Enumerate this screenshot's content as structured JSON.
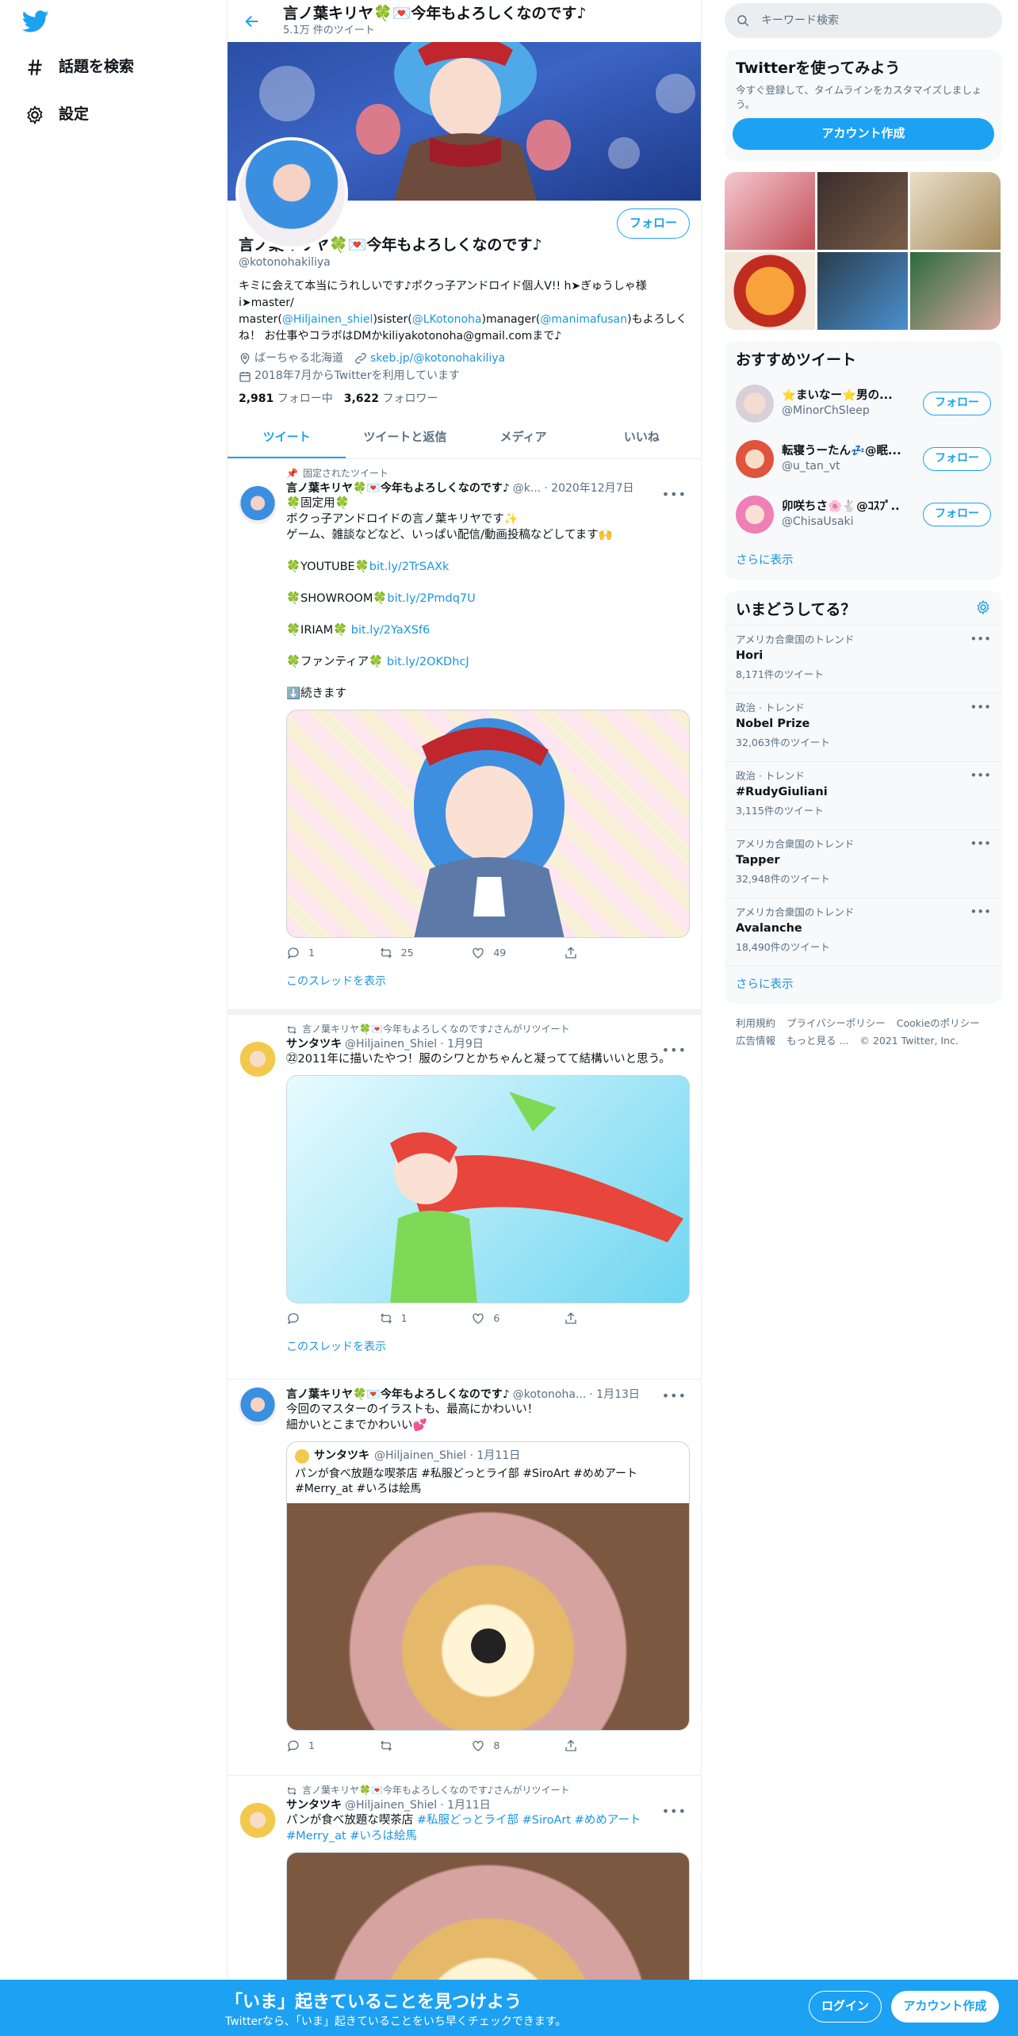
{
  "nav": {
    "explore": "話題を検索",
    "settings": "設定"
  },
  "header": {
    "name": "言ノ葉キリヤ🍀💌今年もよろしくなのです♪",
    "tweet_count": "5.1万 件のツイート"
  },
  "profile": {
    "follow_label": "フォロー",
    "name": "言ノ葉キリヤ🍀💌今年もよろしくなのです♪",
    "handle": "@kotonohakiliya",
    "bio_part1": "キミに会えて本当にうれしいです♪ポクっ子アンドロイド個人V!! h➤ぎゅうしゃ様i➤master/ master(",
    "bio_link1": "@Hiljainen_shiel",
    "bio_part2": ")sister(",
    "bio_link2": "@LKotonoha",
    "bio_part3": ")manager(",
    "bio_link3": "@manimafusan",
    "bio_part4": ")もよろしくね！ お仕事やコラボはDMかkiliyakotonoha@gmail.comまで♪",
    "location": "ばーちゃる北海道",
    "website": "skeb.jp/@kotonohakiliya",
    "joined": "2018年7月からTwitterを利用しています",
    "following_count": "2,981",
    "following_label": "フォロー中",
    "followers_count": "3,622",
    "followers_label": "フォロワー"
  },
  "tabs": [
    "ツイート",
    "ツイートと返信",
    "メディア",
    "いいね"
  ],
  "tweets": [
    {
      "context": "固定されたツイート",
      "name": "言ノ葉キリヤ🍀💌今年もよろしくなのです♪",
      "handle": "@k...",
      "date": "· 2020年12月7日",
      "text": "🍀固定用🍀\nボクっ子アンドロイドの言ノ葉キリヤです✨\nゲーム、雑談などなど、いっぱい配信/動画投稿などしてます🙌",
      "links": [
        {
          "label": "🍀YOUTUBE🍀",
          "url": "bit.ly/2TrSAXk"
        },
        {
          "label": "🍀SHOWROOM🍀",
          "url": "bit.ly/2Pmdq7U"
        },
        {
          "label": "🍀IRIAM🍀 ",
          "url": "bit.ly/2YaXSf6"
        },
        {
          "label": "🍀ファンティア🍀 ",
          "url": "bit.ly/2OKDhcJ"
        }
      ],
      "continue": "⬇️続きます",
      "replies": "1",
      "retweets": "25",
      "likes": "49",
      "show_thread": "このスレッドを表示"
    },
    {
      "context": "言ノ葉キリヤ🍀💌今年もよろしくなのです♪さんがリツイート",
      "name": "サンタツキ",
      "handle": "@Hiljainen_Shiel",
      "date": "· 1月9日",
      "text": "㉒2011年に描いたやつ！服のシワとかちゃんと凝ってて結構いいと思う。",
      "replies": "",
      "retweets": "1",
      "likes": "6",
      "show_thread": "このスレッドを表示"
    },
    {
      "name": "言ノ葉キリヤ🍀💌今年もよろしくなのです♪",
      "handle": "@kotonoha...",
      "date": "· 1月13日",
      "text": "今回のマスターのイラストも、最高にかわいい！\n細かいとこまでかわいい💕",
      "quote": {
        "name": "サンタツキ",
        "handle": "@Hiljainen_Shiel · 1月11日",
        "text": "パンが食べ放題な喫茶店 #私服どっとライ部 #SiroArt #めめアート #Merry_at #いろは絵馬"
      },
      "replies": "1",
      "retweets": "",
      "likes": "8"
    },
    {
      "context": "言ノ葉キリヤ🍀💌今年もよろしくなのです♪さんがリツイート",
      "name": "サンタツキ",
      "handle": "@Hiljainen_Shiel",
      "date": "· 1月11日",
      "text_plain": "パンが食べ放題な喫茶店 ",
      "text_tags": "#私服どっとライ部 #SiroArt #めめアート",
      "text_tags2": "#Merry_at #いろは絵馬"
    }
  ],
  "right": {
    "search_placeholder": "キーワード検索",
    "signup_card": {
      "title": "Twitterを使ってみよう",
      "desc": "今すぐ登録して、タイムラインをカスタマイズしましょう。",
      "button": "アカウント作成"
    },
    "recommend": {
      "title": "おすすめツイート",
      "items": [
        {
          "name": "⭐まいなー⭐男の...",
          "handle": "@MinorChSleep",
          "button": "フォロー"
        },
        {
          "name": "転寝うーたん💤@眠...",
          "handle": "@u_tan_vt",
          "button": "フォロー"
        },
        {
          "name": "卯咲ちさ🌸🐇@ｺｽﾌﾟ...",
          "handle": "@ChisaUsaki",
          "button": "フォロー"
        }
      ],
      "more": "さらに表示"
    },
    "trends": {
      "title": "いまどうしてる？",
      "items": [
        {
          "category": "アメリカ合衆国のトレンド",
          "name": "Hori",
          "count": "8,171件のツイート"
        },
        {
          "category": "政治 · トレンド",
          "name": "Nobel Prize",
          "count": "32,063件のツイート"
        },
        {
          "category": "政治 · トレンド",
          "name": "#RudyGiuliani",
          "count": "3,115件のツイート"
        },
        {
          "category": "アメリカ合衆国のトレンド",
          "name": "Tapper",
          "count": "32,948件のツイート"
        },
        {
          "category": "アメリカ合衆国のトレンド",
          "name": "Avalanche",
          "count": "18,490件のツイート"
        }
      ],
      "more": "さらに表示"
    },
    "footer": {
      "terms": "利用規約",
      "privacy": "プライバシーポリシー",
      "cookie": "Cookieのポリシー",
      "ads": "広告情報",
      "more": "もっと見る ...",
      "copyright": "© 2021 Twitter, Inc."
    }
  },
  "bottom_bar": {
    "title": "「いま」起きていることを見つけよう",
    "subtitle": "Twitterなら、「いま」起きていることをいち早くチェックできます。",
    "login": "ログイン",
    "signup": "アカウント作成"
  },
  "colors": {
    "accent": "#1da1f2",
    "text": "#0f1419",
    "muted": "#5b7083",
    "border": "#ebeef0"
  }
}
